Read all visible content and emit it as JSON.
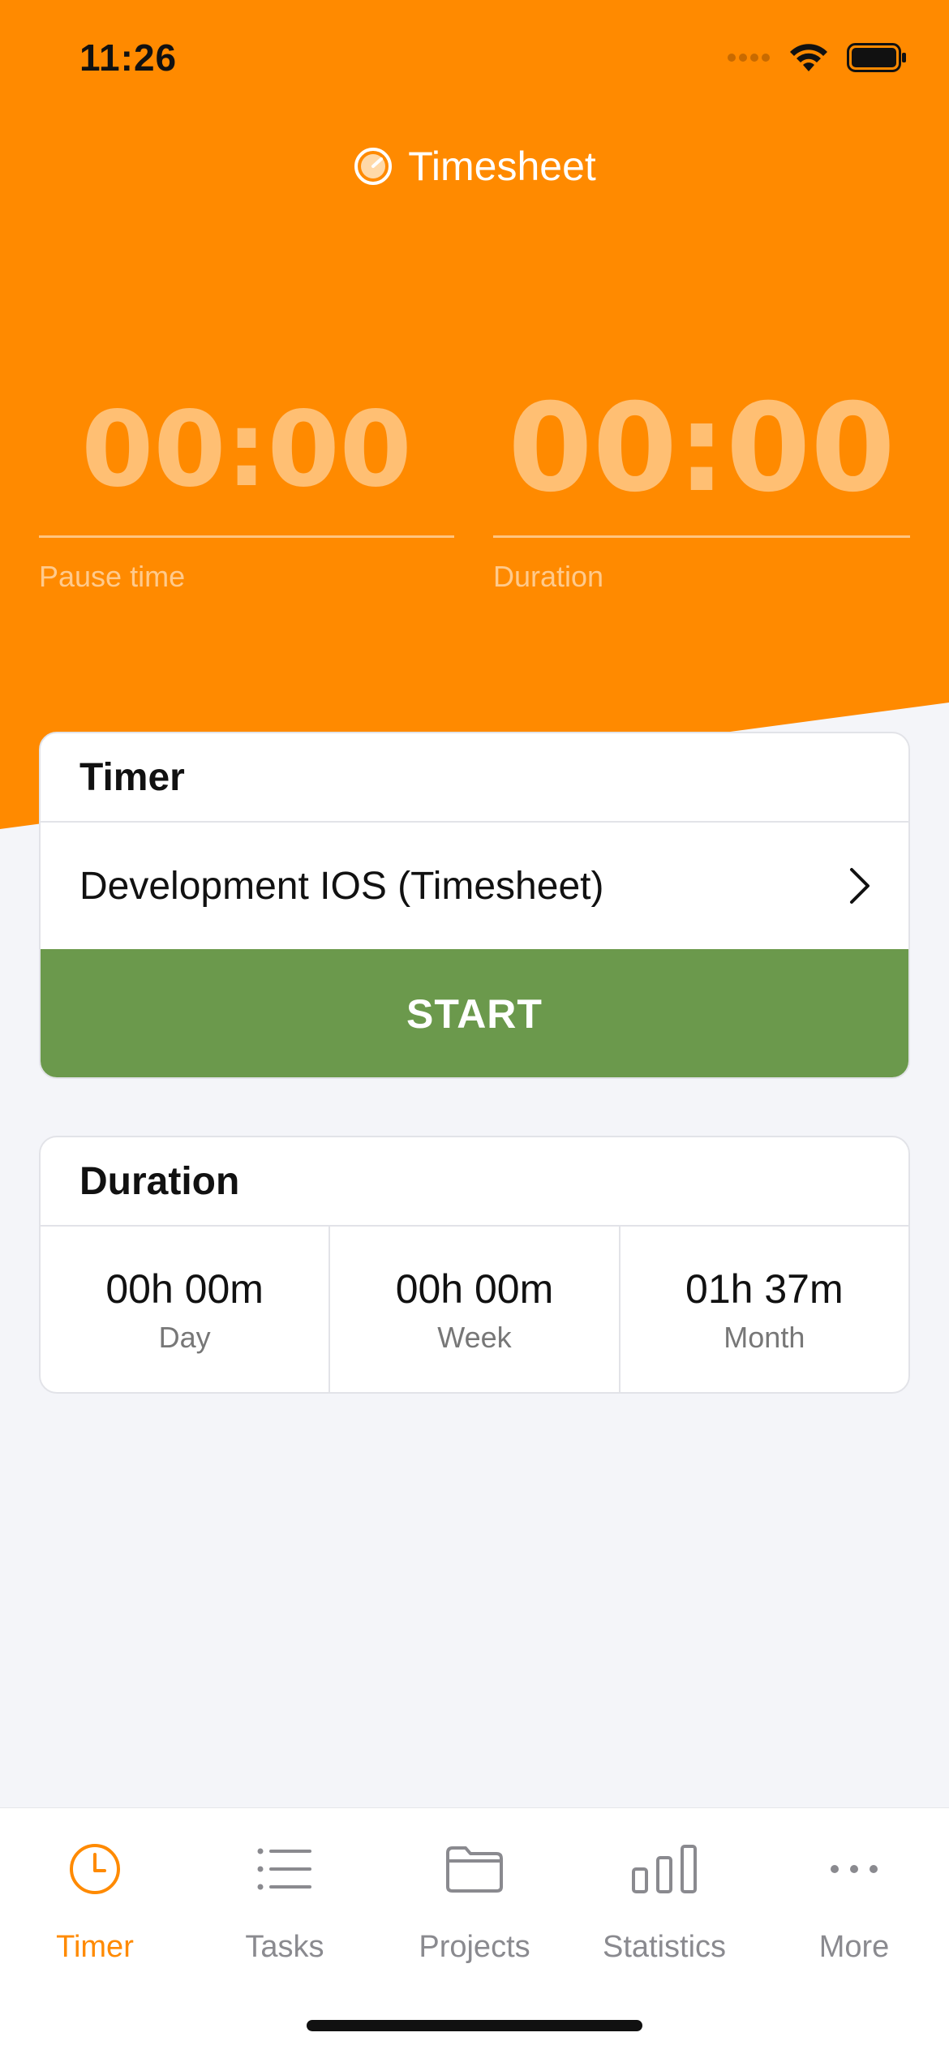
{
  "status_bar": {
    "time": "11:26"
  },
  "app": {
    "title": "Timesheet",
    "accent_color": "#ff8a00"
  },
  "timers": {
    "pause": {
      "value": "00:00",
      "label": "Pause time"
    },
    "duration": {
      "value": "00:00",
      "label": "Duration"
    }
  },
  "timer_card": {
    "title": "Timer",
    "task": "Development IOS (Timesheet)",
    "start_label": "START",
    "start_color": "#6b994c"
  },
  "duration_card": {
    "title": "Duration",
    "stats": [
      {
        "value": "00h 00m",
        "label": "Day"
      },
      {
        "value": "00h 00m",
        "label": "Week"
      },
      {
        "value": "01h 37m",
        "label": "Month"
      }
    ]
  },
  "tab_bar": {
    "items": [
      {
        "label": "Timer",
        "icon": "clock-icon",
        "active": true
      },
      {
        "label": "Tasks",
        "icon": "list-icon",
        "active": false
      },
      {
        "label": "Projects",
        "icon": "folder-icon",
        "active": false
      },
      {
        "label": "Statistics",
        "icon": "bar-chart-icon",
        "active": false
      },
      {
        "label": "More",
        "icon": "more-icon",
        "active": false
      }
    ]
  }
}
